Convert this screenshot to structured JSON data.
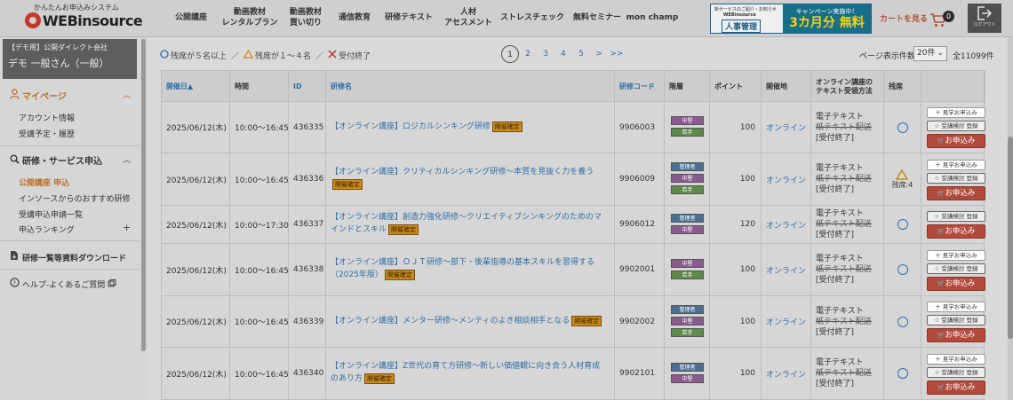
{
  "header": {
    "tagline": "かんたんお申込みシステム",
    "logo_text": "WEBinsource",
    "nav": [
      {
        "label": "公開講座"
      },
      {
        "label": "動画教材\nレンタルプラン"
      },
      {
        "label": "動画教材\n買い切り"
      },
      {
        "label": "通信教育"
      },
      {
        "label": "研修テキスト"
      },
      {
        "label": "人材\nアセスメント"
      },
      {
        "label": "ストレスチェック"
      },
      {
        "label": "無料セミナー"
      },
      {
        "label": "mon champ"
      }
    ],
    "campaign": {
      "small": "新サービスのご紹介・お知らせ",
      "sub": "WEBinsource",
      "product": "人事管理",
      "title": "キャンペーン実施中！",
      "big": "3カ月分 無料"
    },
    "cart_label": "カートを見る",
    "cart_count": "0",
    "logout_label": "ログアウト"
  },
  "sidebar": {
    "company": "【デモ用】公開ダイレクト会社",
    "user": "デモ 一般さん（一般）",
    "mypage": "マイページ",
    "mypage_items": [
      "アカウント情報",
      "受講予定・履歴"
    ],
    "training": "研修・サービス申込",
    "training_items": [
      "公開講座 申込",
      "インソースからのおすすめ研修",
      "受講申込申請一覧",
      "申込ランキング"
    ],
    "download": "研修一覧等資料ダウンロード",
    "help": "ヘルプ-よくあるご質問"
  },
  "legend": {
    "a": "残席が５名以上",
    "b": "残席が１～４名",
    "c": "受付終了"
  },
  "pager": {
    "pages": [
      "1",
      "2",
      "3",
      "4",
      "5",
      ">",
      ">>"
    ],
    "current": "1"
  },
  "perpage": {
    "label": "ページ表示件数",
    "value": "20件",
    "total": "全11099件"
  },
  "table": {
    "headers": [
      "開催日▲",
      "時間",
      "ID",
      "研修名",
      "研修コード",
      "階層",
      "ポイント",
      "開催地",
      "オンライン講座の\nテキスト受領方法",
      "残席"
    ],
    "badge": "開催確定",
    "text_method": [
      "電子テキスト",
      "紙テキスト配送",
      "[受付終了]"
    ],
    "btn_tour": "＋ 見学お申込み",
    "btn_consider": "☆ 受講検討 登録",
    "btn_apply": "お申込み",
    "rows": [
      {
        "date": "2025/06/12(木)",
        "time": "10:00～16:45",
        "id": "436335",
        "name": "【オンライン講座】ロジカルシンキング研修",
        "code": "9906003",
        "levels": [
          "中堅",
          "若手"
        ],
        "points": "100",
        "loc": "オンライン",
        "seats": "circle",
        "tour": true
      },
      {
        "date": "2025/06/12(木)",
        "time": "10:00～16:45",
        "id": "436336",
        "name": "【オンライン講座】クリティカルシンキング研修～本質を見抜く力を養う",
        "code": "9906009",
        "levels": [
          "管理者",
          "中堅",
          "若手"
        ],
        "points": "100",
        "loc": "オンライン",
        "seats": "warn",
        "seats_text": "残席:4",
        "tour": true
      },
      {
        "date": "2025/06/12(木)",
        "time": "10:00～17:30",
        "id": "436337",
        "name": "【オンライン講座】創造力強化研修～クリエイティブシンキングのためのマインドとスキル",
        "code": "9906012",
        "levels": [
          "管理者",
          "中堅"
        ],
        "points": "120",
        "loc": "オンライン",
        "seats": "circle",
        "tour": false
      },
      {
        "date": "2025/06/12(木)",
        "time": "10:00～16:45",
        "id": "436338",
        "name": "【オンライン講座】ＯＪＴ研修～部下・後輩指導の基本スキルを習得する（2025年版）",
        "code": "9902001",
        "levels": [
          "中堅",
          "若手"
        ],
        "points": "100",
        "loc": "オンライン",
        "seats": "circle",
        "tour": true
      },
      {
        "date": "2025/06/12(木)",
        "time": "10:00～16:45",
        "id": "436339",
        "name": "【オンライン講座】メンター研修～メンティのよき相談相手となる",
        "code": "9902002",
        "levels": [
          "管理者",
          "中堅",
          "若手"
        ],
        "points": "100",
        "loc": "オンライン",
        "seats": "circle",
        "tour": true
      },
      {
        "date": "2025/06/12(木)",
        "time": "10:00～16:45",
        "id": "436340",
        "name": "【オンライン講座】Z世代の育て方研修～新しい価値観に向き合う人材育成のあり方",
        "code": "9902101",
        "levels": [
          "管理者",
          "中堅"
        ],
        "points": "100",
        "loc": "オンライン",
        "seats": "circle",
        "tour": true
      }
    ]
  }
}
